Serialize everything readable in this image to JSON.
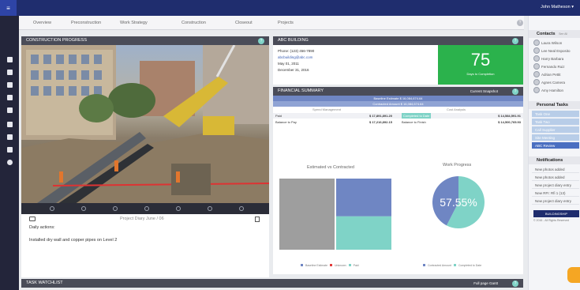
{
  "topbar": {
    "logo": "≡",
    "user": "John Matheson ▾"
  },
  "tabs": [
    "Overview",
    "Preconstruction",
    "Work Strategy",
    "Construction",
    "Closeout",
    "Projects"
  ],
  "construction": {
    "title": "CONSTRUCTION PROGRESS",
    "diary_label": "Project Diary June / 06",
    "daily_actions": "Daily actions:",
    "note": "Installed dry wall and copper pipes on Level 2"
  },
  "abc": {
    "title": "ABC BUILDING",
    "phone": "Phone: (123) 456-7890",
    "email": "abcbuilding@abc.com",
    "date1": "May 01, 2011",
    "date2": "December 31, 2016",
    "big_number": "75",
    "big_caption": "Days to Completion"
  },
  "financial": {
    "title": "FINANCIAL SUMMARY",
    "link": "Current Snapshot",
    "baseline": "Baseline Estimate  $ 16,084,674.64",
    "contracted": "Contracted Amount  $ 16,084,674.64",
    "col1": "Spend Management",
    "col2": "Cost Analysis",
    "rows": [
      {
        "label": "Paid",
        "val1": "$ 17,891,891.20",
        "mid": "Completed to Date",
        "val2": "$ 14,584,591.91"
      },
      {
        "label": "Balance to Pay",
        "val1": "$ 17,216,892.15",
        "mid": "Balance to Finish",
        "val2": "$ 14,500,765.93"
      }
    ]
  },
  "charts_titles": {
    "left": "Estimated vs Contracted",
    "right": "Work Progress"
  },
  "legend_left": [
    "Baseline Estimate",
    "Unknown",
    "Paid"
  ],
  "legend_right": [
    "Contracted Amount",
    "Completed to Date"
  ],
  "watchlist": {
    "title": "TASK WATCHLIST",
    "link": "Full page Gantt"
  },
  "right_panel": {
    "contacts_title": "Contacts",
    "contacts_more": "See All",
    "contacts": [
      "Laura Wilson",
      "Lee Neal Esposito",
      "Harry Barbara",
      "Fernando Ruiz",
      "Adrian Pettit",
      "Agnes Camera",
      "Amy Hamilton"
    ],
    "tasks_title": "Personal Tasks",
    "tasks": [
      "Task One",
      "Task Two",
      "Call Supplier",
      "Site Meeting",
      "ABC Review"
    ],
    "notifications_title": "Notifications",
    "notifications": [
      "New photos added",
      "New photos added",
      "New project diary entry",
      "New RFI: Rfi 1 (13)",
      "New project diary entry"
    ],
    "brand": "BUILDINGSHIP",
    "copyright": "© 2016 - All Rights Reserved"
  },
  "colors": {
    "accent": "#2bb24c",
    "navy": "#1f2d6e",
    "teal": "#7fd3c7",
    "blue": "#6f86c3"
  },
  "chart_data": [
    {
      "type": "bar",
      "title": "Estimated vs Contracted",
      "series": [
        {
          "name": "Baseline Estimate",
          "values": [
            100
          ]
        },
        {
          "name": "Paid",
          "values": [
            47
          ]
        },
        {
          "name": "Unknown",
          "values": [
            53
          ]
        }
      ],
      "ylim": [
        0,
        100
      ]
    },
    {
      "type": "pie",
      "title": "Work Progress",
      "labels": [
        "Completed to Date",
        "Contracted Amount"
      ],
      "values": [
        57.55,
        42.45
      ],
      "center_label": "57.55%"
    }
  ]
}
